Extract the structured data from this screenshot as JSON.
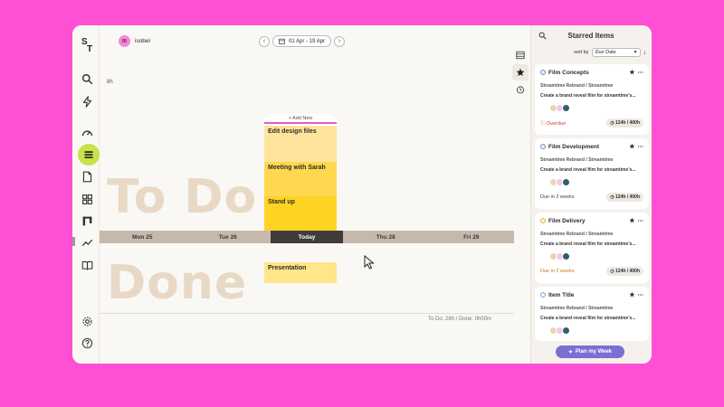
{
  "user": {
    "initials": "IB",
    "name": "isobel"
  },
  "date_range": {
    "label": "01 Apr - 19 Apr"
  },
  "hours_label": "8h",
  "background_words": {
    "todo": "To Do",
    "done": "Done"
  },
  "today": {
    "add_new": "+ Add New",
    "todo_tasks": [
      "Edit design files",
      "Meeting with Sarah",
      "Stand up"
    ],
    "done_tasks": [
      "Presentation"
    ]
  },
  "days": [
    "Mon 25",
    "Tue 26",
    "Today",
    "Thu 28",
    "Fri 29"
  ],
  "totals": "To Do: 28h / Done: 0h00m",
  "panel": {
    "title": "Starred Items",
    "sort_label": "sort by",
    "sort_value": "Due Date",
    "plan_button": "Plan my Week",
    "cards": [
      {
        "title": "Film Concepts",
        "project": "Streamtime Rebrand / Streamtime",
        "description": "Create a brand reveal film for streamtime's...",
        "due": "Overdue",
        "due_style": "overdue",
        "hours": "124h / 400h",
        "icon_color": "#5b6fcf"
      },
      {
        "title": "Film Development",
        "project": "Streamtime Rebrand / Streamtime",
        "description": "Create a brand reveal film for streamtime's...",
        "due": "Due in 2 weeks",
        "due_style": "due",
        "hours": "124h / 400h",
        "icon_color": "#5b6fcf"
      },
      {
        "title": "Film Delivery",
        "project": "Streamtime Rebrand / Streamtime",
        "description": "Create a brand reveal film for streamtime's...",
        "due": "Due in 2 weeks",
        "due_style": "due-warn",
        "hours": "124h / 400h",
        "icon_color": "#e7a019"
      },
      {
        "title": "Item Title",
        "project": "Streamtime Rebrand / Streamtime",
        "description": "Create a brand reveal film for streamtime's...",
        "due": "",
        "due_style": "due",
        "hours": "",
        "icon_color": "#7c8be0"
      }
    ]
  },
  "colors": {
    "background": "#ff4fd2",
    "accent_green": "#c7e24a",
    "task_yellow": "#ffd324",
    "plan_purple": "#7a6fd3"
  }
}
